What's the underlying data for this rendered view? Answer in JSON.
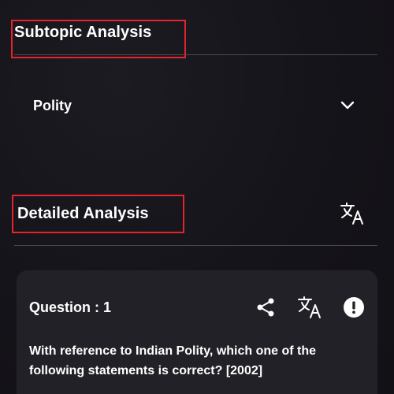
{
  "subtopic_section": {
    "title": "Subtopic Analysis",
    "dropdown": {
      "selected": "Polity",
      "icon": "chevron-down-icon"
    }
  },
  "detailed_section": {
    "title": "Detailed Analysis",
    "translate_icon": "translate-icon"
  },
  "question_card": {
    "label": "Question : 1",
    "actions": [
      "share-icon",
      "translate-icon",
      "info-alert-icon"
    ],
    "text": "With reference to Indian Polity, which one of the following statements is correct? [2002]"
  },
  "colors": {
    "background": "#15141a",
    "card": "#222127",
    "highlight": "#e6232b",
    "text": "#ffffff"
  }
}
